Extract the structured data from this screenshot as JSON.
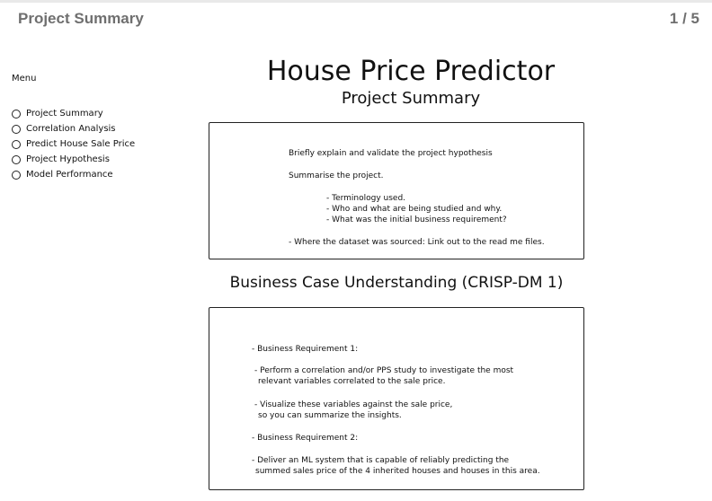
{
  "header": {
    "title": "Project Summary",
    "page_indicator": "1 / 5"
  },
  "sidebar": {
    "heading": "Menu",
    "items": [
      {
        "label": "Project Summary"
      },
      {
        "label": "Correlation Analysis"
      },
      {
        "label": "Predict House Sale Price"
      },
      {
        "label": "Project Hypothesis"
      },
      {
        "label": "Model Performance"
      }
    ]
  },
  "main": {
    "title": "House Price Predictor",
    "subtitle": "Project Summary",
    "summary_box": {
      "line1": "Briefly explain and validate the project hypothesis",
      "line2": "Summarise the project.",
      "line3": "- Terminology used.",
      "line4": "- Who and what are being studied and why.",
      "line5": "- What was the initial business requirement?",
      "line6": "- Where the dataset was sourced: Link out to the read me files."
    },
    "section_heading": "Business Case Understanding (CRISP-DM 1)",
    "business_box": {
      "line1": "- Business Requirement 1:",
      "line2": "- Perform a correlation and/or PPS study to investigate the most",
      "line3": "relevant variables correlated to the sale price.",
      "line4": "- Visualize these variables against the sale price,",
      "line5": "so you can summarize the insights.",
      "line6": "- Business Requirement 2:",
      "line7": "- Deliver an ML system that is capable of reliably predicting the",
      "line8": "summed sales price of the 4 inherited houses and houses in this area."
    }
  }
}
